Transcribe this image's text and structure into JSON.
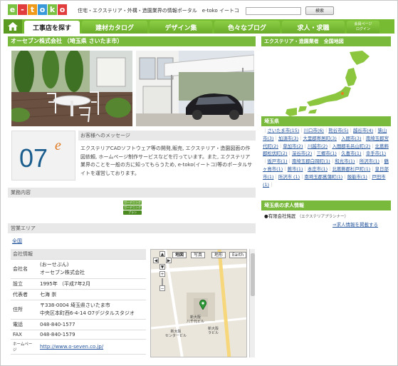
{
  "header": {
    "logo_letters": [
      "e",
      "-",
      "t",
      "o",
      "k",
      "o"
    ],
    "tagline": "住宅・エクステリア・外構・造園業界の情報ポータル　e-toko イートコ",
    "search_placeholder": "",
    "search_button": "検索"
  },
  "nav": {
    "items": [
      "工事店を探す",
      "建材カタログ",
      "デザイン集",
      "色々なブログ",
      "求人・求職"
    ],
    "login": "会員ページ\nログイン"
  },
  "company": {
    "heading": "オーセブン株式会社 （埼玉県 さいたま市）",
    "logo_text": "07",
    "logo_sup": "e",
    "message_title": "お客様へのメッセージ",
    "message_body": "エクステリアCADソフトウェア等の開発,販売, エクステリア・造園図面の作図依頼, ホームページ制作サービスなどを行っています。また, エクステリア業界のことを一般の方に知ってもらうため, e-toko(イートコ)等のポータルサイトを運営しております。",
    "services_title": "業務内容",
    "services": [
      "ガーデニング",
      "ガーデニング",
      "プラン"
    ],
    "area_title": "営業エリア",
    "area_link": "全国",
    "info_title": "会社情報",
    "info": [
      {
        "key": "会社名",
        "value": "(おーせぶん)\nオーセブン株式会社"
      },
      {
        "key": "設立",
        "value": "1995年 （平成7年2月"
      },
      {
        "key": "代表者",
        "value": "七海 崇"
      },
      {
        "key": "住所",
        "value": "〒338-0004 埼玉県さいたま市\n中央区本町西6-4-14 O7デジタルスタジオ"
      },
      {
        "key": "電話",
        "value": "048-840-1577"
      },
      {
        "key": "FAX",
        "value": "048-840-1579"
      },
      {
        "key": "ホームページ",
        "value": "http://www.o-seven.co.jp/"
      }
    ]
  },
  "map": {
    "types": [
      "地図",
      "写真",
      "地形",
      "Earth"
    ],
    "labels": [
      "新大阪\n八千代ビル",
      "新大阪\nセンタービル",
      "新大阪\nラビル"
    ]
  },
  "sidebar": {
    "map_heading": "エクステリア・造園業者　全国地図",
    "pref_heading": "埼玉県",
    "cities": [
      "さいたま市(15)",
      "川口市(6)",
      "熊谷市(5)",
      "越谷市(4)",
      "狭山市(3)",
      "加須市(3)",
      "大里郡寄居町(3)",
      "入間市(3)",
      "南埼玉郡宮代町(2)",
      "草加市(2)",
      "川越市(2)",
      "入間郡毛呂山町(2)",
      "北葛飾郡松伏町(2)",
      "深谷市(2)",
      "三郷市(1)",
      "久喜市(1)",
      "幸手市(1)",
      "坂戸市(1)",
      "南埼玉郡白岡町(1)",
      "和光市(1)",
      "所沢市(1)",
      "鶴ヶ島市(1)",
      "蕨市(1)",
      "本庄市(1)",
      "北葛飾郡杉戸町(1)",
      "皇日部市(1)",
      "所沢市 (1)",
      "南埼玉郡菖蒲町(1)",
      "飯能市(1)",
      "戸田市(1)"
    ],
    "jobs_heading": "埼玉県の求人情報",
    "job_company": "●有限会社銘匠",
    "job_tag": "（エクステリアプランナー）",
    "job_post_link": "⇒求人情報を掲載する"
  }
}
